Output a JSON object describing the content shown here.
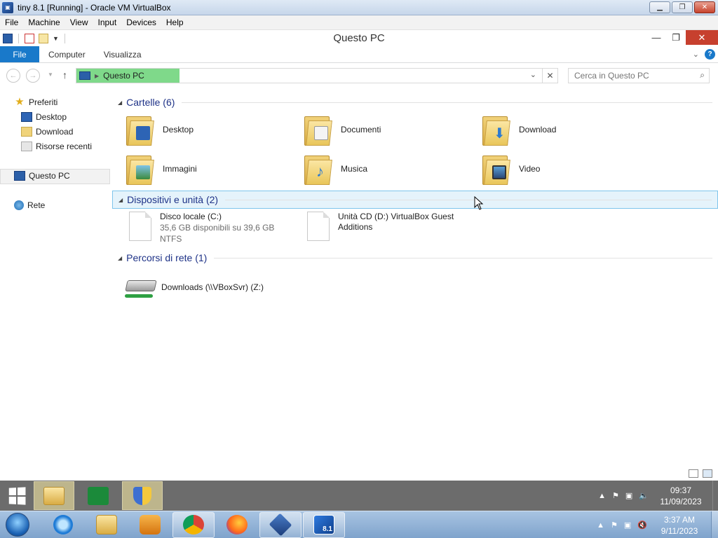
{
  "host_window": {
    "title": "tiny 8.1 [Running] - Oracle VM VirtualBox",
    "menu": [
      "File",
      "Machine",
      "View",
      "Input",
      "Devices",
      "Help"
    ]
  },
  "explorer": {
    "title": "Questo PC",
    "ribbon_tabs": {
      "file": "File",
      "computer": "Computer",
      "view": "Visualizza"
    },
    "address": {
      "crumb": "Questo PC"
    },
    "search": {
      "placeholder": "Cerca in Questo PC"
    },
    "sidebar": {
      "favorites": "Preferiti",
      "favorites_items": [
        "Desktop",
        "Download",
        "Risorse recenti"
      ],
      "this_pc": "Questo PC",
      "network": "Rete"
    },
    "groups": {
      "folders": {
        "title": "Cartelle (6)",
        "items": [
          "Desktop",
          "Documenti",
          "Download",
          "Immagini",
          "Musica",
          "Video"
        ]
      },
      "devices": {
        "title": "Dispositivi e unità (2)",
        "local_disk": {
          "name": "Disco locale (C:)",
          "space": "35,6 GB disponibili su 39,6 GB",
          "fs": "NTFS"
        },
        "cd_drive": {
          "name_line1": "Unità CD (D:) VirtualBox Guest",
          "name_line2": "Additions"
        }
      },
      "network_locations": {
        "title": "Percorsi di rete (1)",
        "item": "Downloads (\\\\VBoxSvr) (Z:)"
      }
    }
  },
  "guest_taskbar": {
    "time": "09:37",
    "date": "11/09/2023"
  },
  "host_taskbar": {
    "time": "3:37 AM",
    "date": "9/11/2023",
    "vm_badge": "8.1"
  },
  "colors": {
    "ribbon_file": "#1979ca",
    "breadcrumb_bg": "#7fd98a",
    "group_title": "#1e3287",
    "close_red": "#c7402e"
  }
}
